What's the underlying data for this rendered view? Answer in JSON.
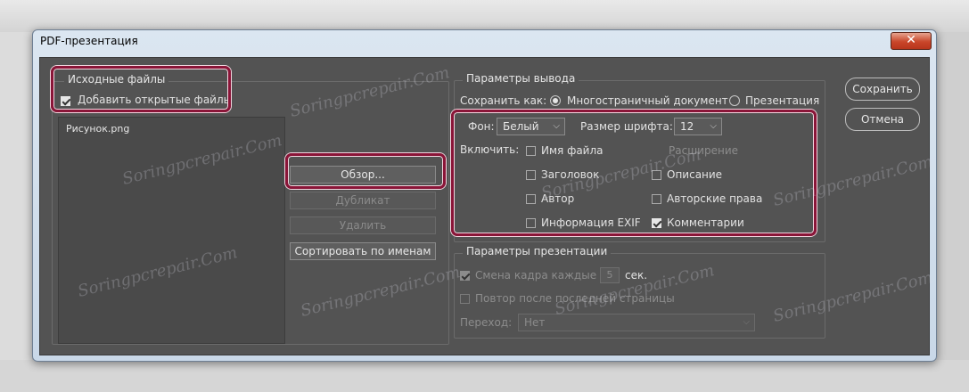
{
  "window": {
    "title": "PDF-презентация",
    "close_glyph": "✕"
  },
  "source": {
    "legend": "Исходные файлы",
    "add_open_files_label": "Добавить открытые файлы",
    "add_open_files_checked": true,
    "files": [
      "Рисунок.png"
    ],
    "browse_label": "Обзор...",
    "duplicate_label": "Дубликат",
    "remove_label": "Удалить",
    "sort_label": "Сортировать по именам"
  },
  "output": {
    "legend": "Параметры вывода",
    "save_as_label": "Сохранить как:",
    "save_as_options": [
      "Многостраничный документ",
      "Презентация"
    ],
    "save_as_selected": "Многостраничный документ",
    "background_label": "Фон:",
    "background_value": "Белый",
    "font_size_label": "Размер шрифта:",
    "font_size_value": "12",
    "include_label": "Включить:",
    "include": {
      "filename": {
        "label": "Имя файла",
        "checked": false
      },
      "extension": {
        "label": "Расширение",
        "checked": false,
        "disabled": true
      },
      "title": {
        "label": "Заголовок",
        "checked": false
      },
      "description": {
        "label": "Описание",
        "checked": false
      },
      "author": {
        "label": "Автор",
        "checked": false
      },
      "copyright": {
        "label": "Авторские права",
        "checked": false
      },
      "exif": {
        "label": "Информация EXIF",
        "checked": false
      },
      "comments": {
        "label": "Комментарии",
        "checked": true
      }
    }
  },
  "presentation": {
    "legend": "Параметры презентации",
    "advance_label": "Смена кадра каждые",
    "advance_value": "5",
    "advance_unit": "сек.",
    "loop_label": "Повтор после последней страницы",
    "transition_label": "Переход:",
    "transition_value": "Нет"
  },
  "actions": {
    "save_label": "Сохранить",
    "cancel_label": "Отмена"
  },
  "watermark": "Soringpcrepair.Com",
  "colors": {
    "highlight": "#8a1538",
    "panel": "#535353",
    "close": "#c9462a"
  }
}
